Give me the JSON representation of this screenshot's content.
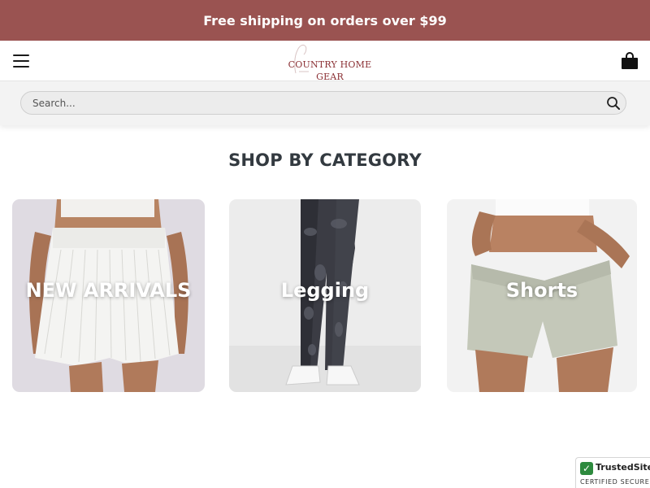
{
  "promo": {
    "text": "Free shipping on orders over $99"
  },
  "header": {
    "logo_line1": "COUNTRY HOME",
    "logo_line2": "GEAR",
    "menu_icon": "hamburger-menu-icon",
    "cart_icon": "shopping-bag-icon"
  },
  "search": {
    "placeholder": "Search...",
    "icon": "search-icon"
  },
  "section": {
    "title": "SHOP BY CATEGORY"
  },
  "categories": [
    {
      "label": "NEW ARRIVALS"
    },
    {
      "label": "Legging"
    },
    {
      "label": "Shorts"
    }
  ],
  "trust_badge": {
    "name": "TrustedSite",
    "sub": "CERTIFIED SECURE"
  },
  "colors": {
    "promo_bg": "#9a5351",
    "logo": "#8a2f33",
    "title": "#333a40",
    "badge_green": "#2d8a3e"
  }
}
